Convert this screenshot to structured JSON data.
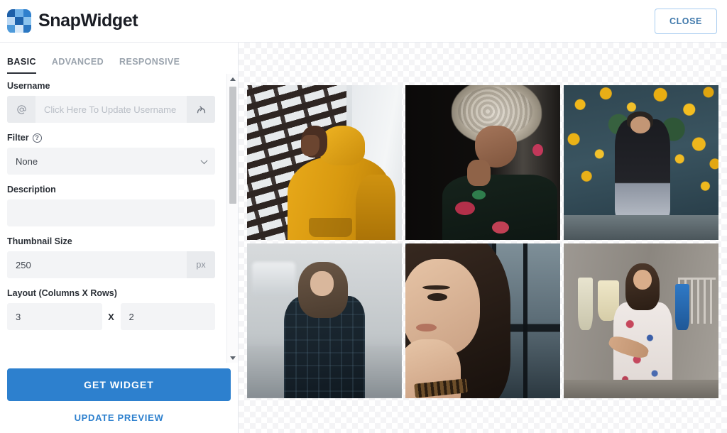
{
  "header": {
    "brand_name": "SnapWidget",
    "logo_icon": "snapwidget-logo-icon",
    "logo_colors": [
      "#1d5fa8",
      "#6fb1e8",
      "#2f80cd",
      "#bcd9f4",
      "#1e63ad",
      "#8cc4ee",
      "#4e9ada",
      "#d6e8f9",
      "#2b77c2"
    ],
    "close_label": "CLOSE"
  },
  "tabs": [
    {
      "label": "BASIC",
      "active": true
    },
    {
      "label": "ADVANCED",
      "active": false
    },
    {
      "label": "RESPONSIVE",
      "active": false
    }
  ],
  "form": {
    "username": {
      "label": "Username",
      "prefix_icon": "at-sign-icon",
      "placeholder": "Click Here To Update Username",
      "value": "",
      "action_icon": "share-arrow-icon"
    },
    "filter": {
      "label": "Filter",
      "help_icon": "question-mark-circle-icon",
      "help_glyph": "?",
      "value": "None",
      "options": [
        "None"
      ],
      "chevron_icon": "chevron-down-icon"
    },
    "description": {
      "label": "Description",
      "value": "",
      "placeholder": ""
    },
    "thumbnail_size": {
      "label": "Thumbnail Size",
      "value": "250",
      "unit": "px"
    },
    "layout": {
      "label": "Layout (Columns X Rows)",
      "columns": "3",
      "separator": "X",
      "rows": "2"
    }
  },
  "actions": {
    "get_widget_label": "GET WIDGET",
    "get_widget_color": "#2d80ce",
    "update_preview_label": "UPDATE PREVIEW",
    "update_preview_color": "#2d80ce"
  },
  "scrollbar": {
    "up_icon": "scroll-up-arrow-icon",
    "down_icon": "scroll-down-arrow-icon",
    "thumb_name": "scrollbar-thumb"
  },
  "preview": {
    "columns": 3,
    "rows": 2,
    "photos": [
      {
        "alt": "person in yellow hoodie by striped building facade"
      },
      {
        "alt": "portrait of woman with voluminous blonde afro in dark floral top"
      },
      {
        "alt": "woman seated among yellow flowers on dark teal backdrop"
      },
      {
        "alt": "woman in dark plaid coat walking on blurred street"
      },
      {
        "alt": "close-up portrait of woman with hand near face and beaded bracelet"
      },
      {
        "alt": "woman in floral dress holding a hose in a courtyard with hanging towels"
      }
    ]
  }
}
